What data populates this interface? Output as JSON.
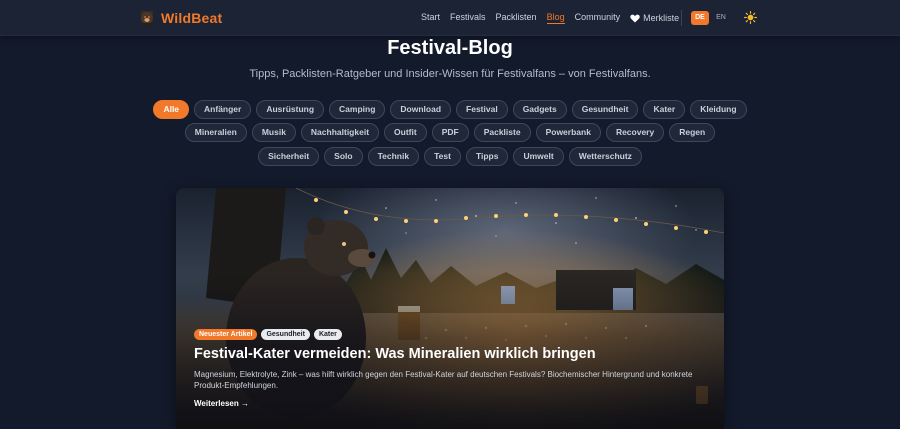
{
  "brand": {
    "name": "WildBeat",
    "logo_icon": "bear-logo-icon",
    "accent": "#f2792a"
  },
  "nav": {
    "links": [
      "Start",
      "Festivals",
      "Packlisten",
      "Blog",
      "Community"
    ],
    "active": "Blog",
    "favorites_label": "Merkliste",
    "favorites_icon": "heart-icon",
    "languages": [
      "DE",
      "EN"
    ],
    "active_language": "DE",
    "theme_icon": "sun-icon"
  },
  "page": {
    "title": "Festival-Blog",
    "subtitle": "Tipps, Packlisten-Ratgeber und Insider-Wissen für Festivalfans – von Festivalfans."
  },
  "filters": {
    "active": "Alle",
    "rows": [
      [
        "Alle",
        "Anfänger",
        "Ausrüstung",
        "Camping",
        "Download",
        "Festival",
        "Gadgets",
        "Gesundheit",
        "Kater",
        "Kleidung"
      ],
      [
        "Mineralien",
        "Musik",
        "Nachhaltigkeit",
        "Outfit",
        "PDF",
        "Packliste",
        "Powerbank",
        "Recovery",
        "Regen"
      ],
      [
        "Sicherheit",
        "Solo",
        "Technik",
        "Test",
        "Tipps",
        "Umwelt",
        "Wetterschutz"
      ]
    ]
  },
  "featured": {
    "badges": [
      "Neuester Artikel",
      "Gesundheit",
      "Kater"
    ],
    "title": "Festival-Kater vermeiden: Was Mineralien wirklich bringen",
    "excerpt": "Magnesium, Elektrolyte, Zink – was hilft wirklich gegen den Festival-Kater auf deutschen Festivals? Biochemischer Hintergrund und konkrete Produkt-Empfehlungen.",
    "read_more": "Weiterlesen →",
    "image_icon": "festival-bear-illustration"
  }
}
